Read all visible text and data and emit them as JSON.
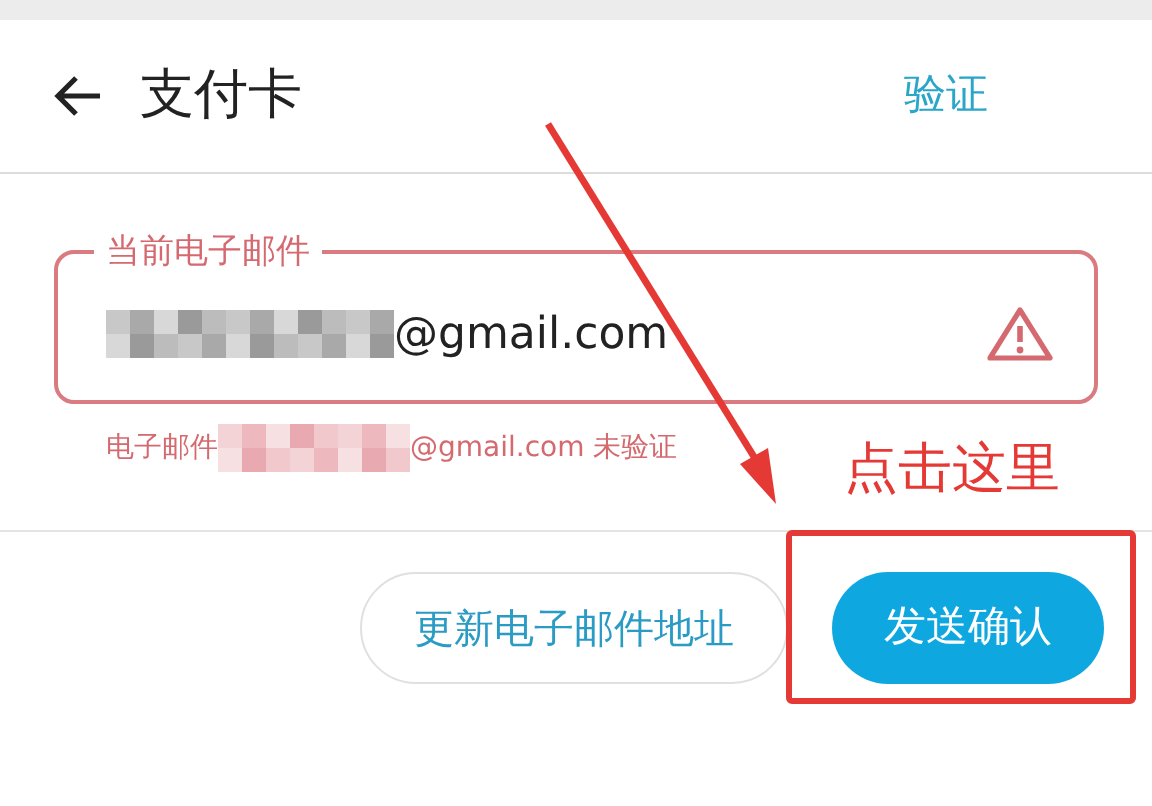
{
  "header": {
    "title": "支付卡",
    "action": "验证"
  },
  "email_field": {
    "label": "当前电子邮件",
    "value_suffix": "@gmail.com",
    "warning": true
  },
  "helper": {
    "prefix": "电子邮件",
    "suffix": "@gmail.com 未验证"
  },
  "buttons": [
    {
      "label": "更新电子邮件地址",
      "kind": "outline"
    },
    {
      "label": "发送确认",
      "kind": "filled"
    }
  ],
  "annotation": {
    "text": "点击这里"
  }
}
